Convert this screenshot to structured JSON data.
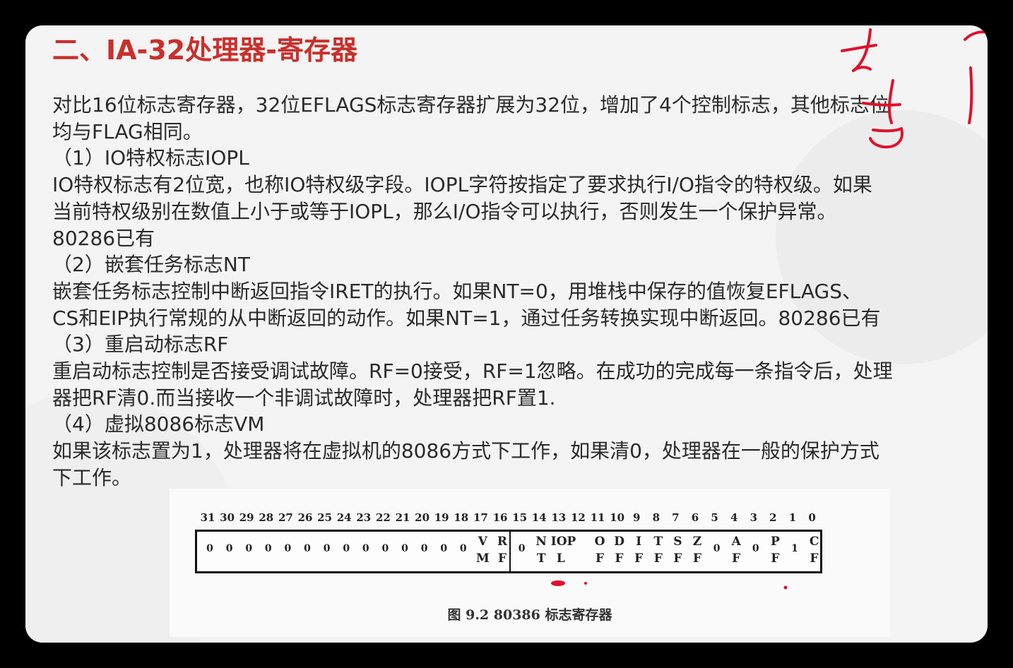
{
  "slide": {
    "title": "二、IA-32处理器-寄存器",
    "paragraphs": [
      "对比16位标志寄存器，32位EFLAGS标志寄存器扩展为32位，增加了4个控制标志，其他标志位",
      "均与FLAG相同。",
      "（1）IO特权标志IOPL",
      "IO特权标志有2位宽，也称IO特权级字段。IOPL字符按指定了要求执行I/O指令的特权级。如果",
      "当前特权级别在数值上小于或等于IOPL，那么I/O指令可以执行，否则发生一个保护异常。",
      "80286已有",
      "（2）嵌套任务标志NT",
      "嵌套任务标志控制中断返回指令IRET的执行。如果NT=0，用堆栈中保存的值恢复EFLAGS、",
      "CS和EIP执行常规的从中断返回的动作。如果NT=1，通过任务转换实现中断返回。80286已有",
      "（3）重启动标志RF",
      "重启动标志控制是否接受调试故障。RF=0接受，RF=1忽略。在成功的完成每一条指令后，处理",
      "器把RF清0.而当接收一个非调试故障时，处理器把RF置1.",
      "（4）虚拟8086标志VM",
      "如果该标志置为1，处理器将在虚拟机的8086方式下工作，如果清0，处理器在一般的保护方式",
      "下工作。"
    ]
  },
  "figure": {
    "bit_numbers": [
      "31",
      "30",
      "29",
      "28",
      "27",
      "26",
      "25",
      "24",
      "23",
      "22",
      "21",
      "20",
      "19",
      "18",
      "17",
      "16",
      "15",
      "14",
      "13",
      "12",
      "11",
      "10",
      "9",
      "8",
      "7",
      "6",
      "5",
      "4",
      "3",
      "2",
      "1",
      "0"
    ],
    "cells": [
      {
        "top": "0",
        "bottom": ""
      },
      {
        "top": "0",
        "bottom": ""
      },
      {
        "top": "0",
        "bottom": ""
      },
      {
        "top": "0",
        "bottom": ""
      },
      {
        "top": "0",
        "bottom": ""
      },
      {
        "top": "0",
        "bottom": ""
      },
      {
        "top": "0",
        "bottom": ""
      },
      {
        "top": "0",
        "bottom": ""
      },
      {
        "top": "0",
        "bottom": ""
      },
      {
        "top": "0",
        "bottom": ""
      },
      {
        "top": "0",
        "bottom": ""
      },
      {
        "top": "0",
        "bottom": ""
      },
      {
        "top": "0",
        "bottom": ""
      },
      {
        "top": "0",
        "bottom": ""
      },
      {
        "top": "V",
        "bottom": "M"
      },
      {
        "top": "R",
        "bottom": "F"
      },
      {
        "top": "0",
        "bottom": ""
      },
      {
        "top": "N",
        "bottom": "T"
      },
      {
        "top": "IOP",
        "bottom": "L"
      },
      {
        "top": "",
        "bottom": ""
      },
      {
        "top": "O",
        "bottom": "F"
      },
      {
        "top": "D",
        "bottom": "F"
      },
      {
        "top": "I",
        "bottom": "F"
      },
      {
        "top": "T",
        "bottom": "F"
      },
      {
        "top": "S",
        "bottom": "F"
      },
      {
        "top": "Z",
        "bottom": "F"
      },
      {
        "top": "0",
        "bottom": ""
      },
      {
        "top": "A",
        "bottom": "F"
      },
      {
        "top": "0",
        "bottom": ""
      },
      {
        "top": "P",
        "bottom": "F"
      },
      {
        "top": "1",
        "bottom": ""
      },
      {
        "top": "C",
        "bottom": "F"
      }
    ],
    "caption": "图 9.2    80386 标志寄存器"
  },
  "colors": {
    "title": "#c9302c",
    "text": "#2a2a2a",
    "ink": "#e0102a",
    "frame": "#000000"
  }
}
